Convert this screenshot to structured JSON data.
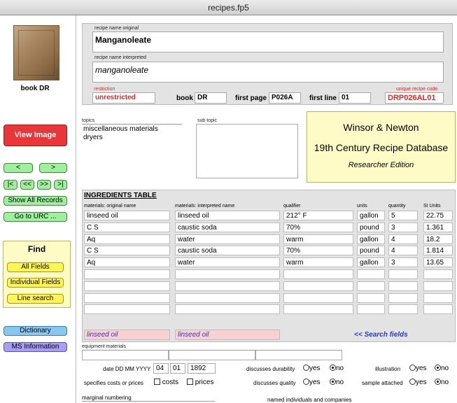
{
  "window": {
    "title": "recipes.fp5"
  },
  "sidebar": {
    "book_caption": "book DR",
    "view_image": "View Image",
    "prev": "<",
    "next": ">",
    "first": "|<",
    "prev_page": "<<",
    "next_page": ">>",
    "last": ">|",
    "show_all": "Show All Records",
    "go_urc": "Go to URC ...",
    "find_title": "Find",
    "all_fields": "All Fields",
    "individual_fields": "Individual Fields",
    "line_search": "Line search",
    "dictionary": "Dictionary",
    "ms_information": "MS Information"
  },
  "record": {
    "name_original_label": "recipe name original",
    "name_original": "Manganoleate",
    "name_interpreted_label": "recipe name interpreted",
    "name_interpreted": "manganoleate",
    "restriction_label": "restriction",
    "restriction": "unrestricted",
    "book_label": "book",
    "book": "DR",
    "first_page_label": "first page",
    "first_page": "P026A",
    "first_line_label": "first line",
    "first_line": "01",
    "unique_code_label": "unique recipe code",
    "unique_code": "DRP026AL01"
  },
  "topics": {
    "label": "topics",
    "items": [
      "miscellaneous materials",
      "dryers"
    ],
    "sub_label": "sub topic"
  },
  "banner": {
    "line1": "Winsor & Newton",
    "line2": "19th Century Recipe Database",
    "line3": "Researcher Edition"
  },
  "ingredients": {
    "title": "INGREDIENTS TABLE",
    "headers": [
      "materials: original name",
      "materials: interpreted name",
      "qualifier",
      "units",
      "quantity",
      "SI Units"
    ],
    "rows": [
      [
        "linseed oil",
        "linseed oil",
        "212° F",
        "gallon",
        "5",
        "22.75"
      ],
      [
        "C S",
        "caustic soda",
        "70%",
        "pound",
        "3",
        "1.361"
      ],
      [
        "Aq",
        "water",
        "warm",
        "gallon",
        "4",
        "18.2"
      ],
      [
        "C S",
        "caustic soda",
        "70%",
        "pound",
        "4",
        "1.814"
      ],
      [
        "Aq",
        "water",
        "warm",
        "gallon",
        "3",
        "13.65"
      ],
      [
        "",
        "",
        "",
        "",
        "",
        ""
      ],
      [
        "",
        "",
        "",
        "",
        "",
        ""
      ],
      [
        "",
        "",
        "",
        "",
        "",
        ""
      ],
      [
        "",
        "",
        "",
        "",
        "",
        ""
      ]
    ],
    "search_original": "linseed oil",
    "search_interpreted": "linseed oil",
    "search_label": "<< Search fields"
  },
  "equipment": {
    "label": "equipment materials"
  },
  "details": {
    "date_label": "date  DD MM YYYY",
    "date_day": "04",
    "date_month": "01",
    "date_year": "1892",
    "costs_label": "specifies costs or prices",
    "costs": "costs",
    "prices": "prices",
    "durability_label": "discusses durability",
    "quality_label": "discusses quality",
    "illustration_label": "illustration",
    "sample_label": "sample attached",
    "yes": "yes",
    "no": "no",
    "marginal_label": "marginal numbering",
    "named_label": "named individuals and companies"
  }
}
